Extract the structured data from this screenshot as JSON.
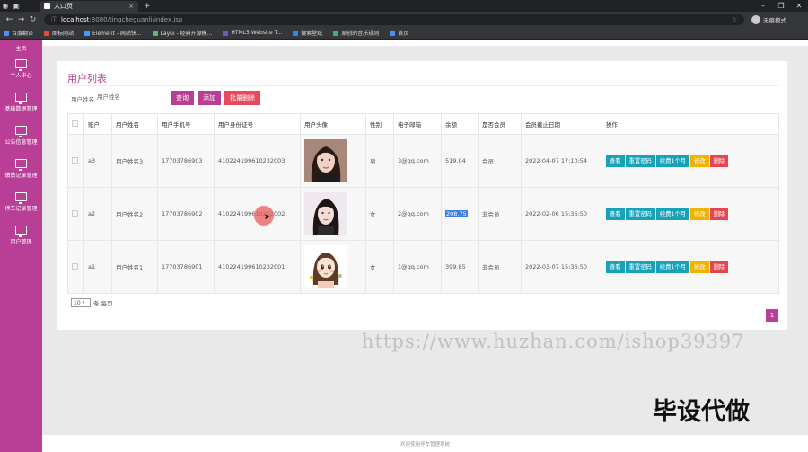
{
  "browser": {
    "tab_title": "入口页",
    "new_tab": "+",
    "url_host": "localhost",
    "url_path": ":8080/tingcheguanli/index.jsp",
    "profile_label": "无痕模式",
    "bookmarks": [
      {
        "label": "百度翻译",
        "color": "#4e8cff"
      },
      {
        "label": "图标网站",
        "color": "#e84b3c"
      },
      {
        "label": "Element - 网站快...",
        "color": "#409eff"
      },
      {
        "label": "Layui - 经典开源模...",
        "color": "#5fb878"
      },
      {
        "label": "HTML5 Website T...",
        "color": "#6a5acd"
      },
      {
        "label": "搜索壁纸",
        "color": "#2d8cf0"
      },
      {
        "label": "原创的音乐规则",
        "color": "#3cb371"
      },
      {
        "label": "首页",
        "color": "#4e8cff"
      }
    ]
  },
  "sidebar": {
    "items": [
      {
        "label": "主页"
      },
      {
        "label": "个人中心"
      },
      {
        "label": "基础数据管理"
      },
      {
        "label": "公告信息管理"
      },
      {
        "label": "缴费记录管理"
      },
      {
        "label": "停车记录管理"
      },
      {
        "label": "用户管理"
      }
    ]
  },
  "card": {
    "title": "用户列表",
    "search_label": "用户姓名",
    "search_placeholder": "用户姓名",
    "btn_search": "查询",
    "btn_add": "添加",
    "btn_batch_delete": "批量删除"
  },
  "table": {
    "headers": [
      "账户",
      "用户姓名",
      "用户手机号",
      "用户身份证号",
      "用户头像",
      "性别",
      "电子邮箱",
      "余额",
      "是否会员",
      "会员截止日期",
      "操作"
    ],
    "rows": [
      {
        "account": "a3",
        "name": "用户姓名3",
        "phone": "17703786903",
        "idcard": "410224199610232003",
        "gender": "男",
        "email": "3@qq.com",
        "balance": "519.04",
        "member": "会员",
        "expire": "2022-04-07 17:10:54"
      },
      {
        "account": "a2",
        "name": "用户姓名2",
        "phone": "17703786902",
        "idcard": "410224199610232002",
        "gender": "女",
        "email": "2@qq.com",
        "balance": "208.75",
        "member": "非会员",
        "expire": "2022-02-06 15:36:50"
      },
      {
        "account": "a1",
        "name": "用户姓名1",
        "phone": "17703786901",
        "idcard": "410224199610232001",
        "gender": "女",
        "email": "1@qq.com",
        "balance": "399.85",
        "member": "非会员",
        "expire": "2022-03-07 15:36:50"
      }
    ],
    "ops": {
      "view": "查看",
      "reset": "重置密码",
      "renew": "续费1个月",
      "edit": "修改",
      "del": "删除"
    }
  },
  "pagination": {
    "page_size": "10",
    "page_size_suffix": "条 每页",
    "current_page": "1"
  },
  "watermark": {
    "url": "https://www.huzhan.com/ishop39397",
    "text": "毕设代做"
  },
  "footer": {
    "text": "欢迎使用停车管理系统"
  },
  "colors": {
    "brand": "#b83f95",
    "danger": "#e64a5c",
    "info": "#17a2b8",
    "warning": "#f0b400"
  }
}
